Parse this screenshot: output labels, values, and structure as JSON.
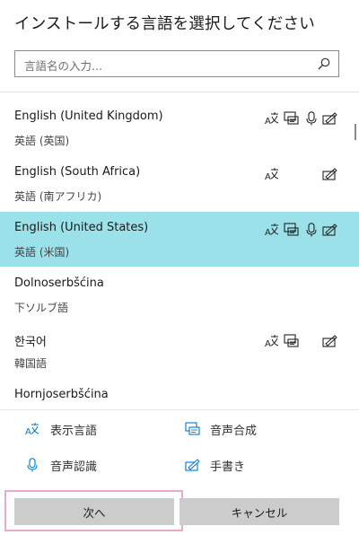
{
  "dialog": {
    "title": "インストールする言語を選択してください"
  },
  "search": {
    "placeholder": "言語名の入力..."
  },
  "languages": [
    {
      "name": "English (United Kingdom)",
      "native": "英語 (英国)",
      "features": [
        "display",
        "tts",
        "speech",
        "handwriting"
      ],
      "selected": false
    },
    {
      "name": "English (South Africa)",
      "native": "英語 (南アフリカ)",
      "features": [
        "display",
        "handwriting"
      ],
      "selected": false
    },
    {
      "name": "English (United States)",
      "native": "英語 (米国)",
      "features": [
        "display",
        "tts",
        "speech",
        "handwriting"
      ],
      "selected": true
    },
    {
      "name": "Dolnoserbšćina",
      "native": "下ソルブ語",
      "features": [],
      "selected": false
    },
    {
      "name": "한국어",
      "native": "韓国語",
      "features": [
        "display",
        "tts",
        "handwriting"
      ],
      "selected": false
    },
    {
      "name": "Hornjoserbšćina",
      "native": "",
      "features": [],
      "selected": false
    }
  ],
  "legend": {
    "display": "表示言語",
    "tts": "音声合成",
    "speech": "音声認識",
    "handwriting": "手書き"
  },
  "buttons": {
    "next": "次へ",
    "cancel": "キャンセル"
  },
  "colors": {
    "selected_row": "#9be1ea",
    "accent": "#0078d7",
    "button": "#cccccc",
    "focus_ring": "#e9a9c9"
  }
}
